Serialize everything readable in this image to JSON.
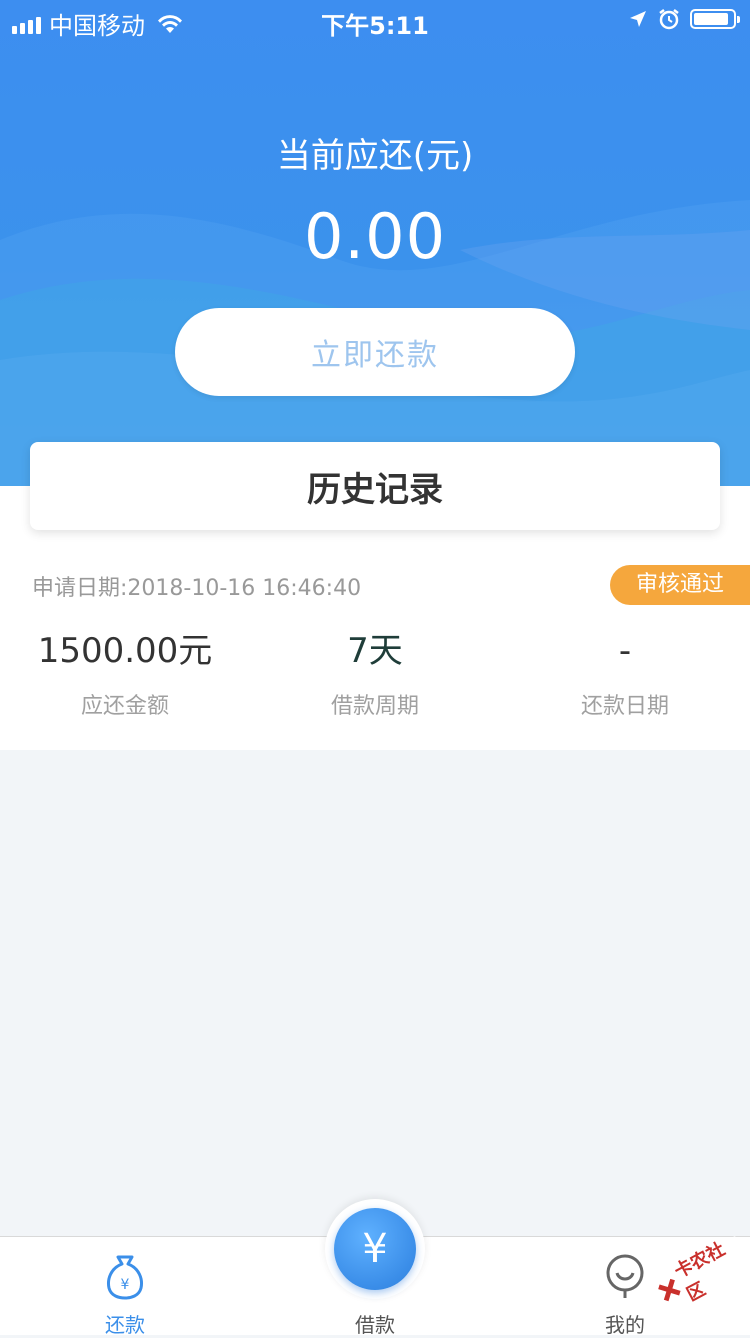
{
  "status_bar": {
    "carrier": "中国移动",
    "time": "下午5:11"
  },
  "header": {
    "due_label": "当前应还(元)",
    "due_amount": "0.00",
    "repay_button": "立即还款"
  },
  "history": {
    "title": "历史记录"
  },
  "record": {
    "apply_date": "申请日期:2018-10-16 16:46:40",
    "status": "审核通过",
    "columns": [
      {
        "value": "1500.00元",
        "label": "应还金额"
      },
      {
        "value": "7天",
        "label": "借款周期"
      },
      {
        "value": "-",
        "label": "还款日期"
      }
    ]
  },
  "tabs": [
    {
      "label": "还款",
      "active": true
    },
    {
      "label": "借款",
      "active": false
    },
    {
      "label": "我的",
      "active": false
    }
  ],
  "center_button_symbol": "¥",
  "watermark": "卡农社区",
  "colors": {
    "primary": "#3b8fe9",
    "badge": "#f5a73d",
    "background": "#f2f5f8"
  }
}
